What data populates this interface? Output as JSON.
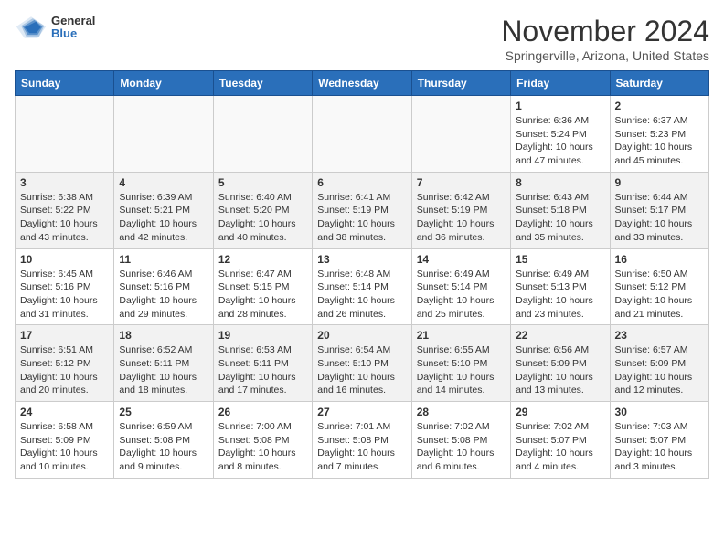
{
  "header": {
    "logo": {
      "general": "General",
      "blue": "Blue"
    },
    "title": "November 2024",
    "subtitle": "Springerville, Arizona, United States"
  },
  "days_of_week": [
    "Sunday",
    "Monday",
    "Tuesday",
    "Wednesday",
    "Thursday",
    "Friday",
    "Saturday"
  ],
  "weeks": [
    [
      {
        "day": "",
        "info": ""
      },
      {
        "day": "",
        "info": ""
      },
      {
        "day": "",
        "info": ""
      },
      {
        "day": "",
        "info": ""
      },
      {
        "day": "",
        "info": ""
      },
      {
        "day": "1",
        "info": "Sunrise: 6:36 AM\nSunset: 5:24 PM\nDaylight: 10 hours and 47 minutes."
      },
      {
        "day": "2",
        "info": "Sunrise: 6:37 AM\nSunset: 5:23 PM\nDaylight: 10 hours and 45 minutes."
      }
    ],
    [
      {
        "day": "3",
        "info": "Sunrise: 6:38 AM\nSunset: 5:22 PM\nDaylight: 10 hours and 43 minutes."
      },
      {
        "day": "4",
        "info": "Sunrise: 6:39 AM\nSunset: 5:21 PM\nDaylight: 10 hours and 42 minutes."
      },
      {
        "day": "5",
        "info": "Sunrise: 6:40 AM\nSunset: 5:20 PM\nDaylight: 10 hours and 40 minutes."
      },
      {
        "day": "6",
        "info": "Sunrise: 6:41 AM\nSunset: 5:19 PM\nDaylight: 10 hours and 38 minutes."
      },
      {
        "day": "7",
        "info": "Sunrise: 6:42 AM\nSunset: 5:19 PM\nDaylight: 10 hours and 36 minutes."
      },
      {
        "day": "8",
        "info": "Sunrise: 6:43 AM\nSunset: 5:18 PM\nDaylight: 10 hours and 35 minutes."
      },
      {
        "day": "9",
        "info": "Sunrise: 6:44 AM\nSunset: 5:17 PM\nDaylight: 10 hours and 33 minutes."
      }
    ],
    [
      {
        "day": "10",
        "info": "Sunrise: 6:45 AM\nSunset: 5:16 PM\nDaylight: 10 hours and 31 minutes."
      },
      {
        "day": "11",
        "info": "Sunrise: 6:46 AM\nSunset: 5:16 PM\nDaylight: 10 hours and 29 minutes."
      },
      {
        "day": "12",
        "info": "Sunrise: 6:47 AM\nSunset: 5:15 PM\nDaylight: 10 hours and 28 minutes."
      },
      {
        "day": "13",
        "info": "Sunrise: 6:48 AM\nSunset: 5:14 PM\nDaylight: 10 hours and 26 minutes."
      },
      {
        "day": "14",
        "info": "Sunrise: 6:49 AM\nSunset: 5:14 PM\nDaylight: 10 hours and 25 minutes."
      },
      {
        "day": "15",
        "info": "Sunrise: 6:49 AM\nSunset: 5:13 PM\nDaylight: 10 hours and 23 minutes."
      },
      {
        "day": "16",
        "info": "Sunrise: 6:50 AM\nSunset: 5:12 PM\nDaylight: 10 hours and 21 minutes."
      }
    ],
    [
      {
        "day": "17",
        "info": "Sunrise: 6:51 AM\nSunset: 5:12 PM\nDaylight: 10 hours and 20 minutes."
      },
      {
        "day": "18",
        "info": "Sunrise: 6:52 AM\nSunset: 5:11 PM\nDaylight: 10 hours and 18 minutes."
      },
      {
        "day": "19",
        "info": "Sunrise: 6:53 AM\nSunset: 5:11 PM\nDaylight: 10 hours and 17 minutes."
      },
      {
        "day": "20",
        "info": "Sunrise: 6:54 AM\nSunset: 5:10 PM\nDaylight: 10 hours and 16 minutes."
      },
      {
        "day": "21",
        "info": "Sunrise: 6:55 AM\nSunset: 5:10 PM\nDaylight: 10 hours and 14 minutes."
      },
      {
        "day": "22",
        "info": "Sunrise: 6:56 AM\nSunset: 5:09 PM\nDaylight: 10 hours and 13 minutes."
      },
      {
        "day": "23",
        "info": "Sunrise: 6:57 AM\nSunset: 5:09 PM\nDaylight: 10 hours and 12 minutes."
      }
    ],
    [
      {
        "day": "24",
        "info": "Sunrise: 6:58 AM\nSunset: 5:09 PM\nDaylight: 10 hours and 10 minutes."
      },
      {
        "day": "25",
        "info": "Sunrise: 6:59 AM\nSunset: 5:08 PM\nDaylight: 10 hours and 9 minutes."
      },
      {
        "day": "26",
        "info": "Sunrise: 7:00 AM\nSunset: 5:08 PM\nDaylight: 10 hours and 8 minutes."
      },
      {
        "day": "27",
        "info": "Sunrise: 7:01 AM\nSunset: 5:08 PM\nDaylight: 10 hours and 7 minutes."
      },
      {
        "day": "28",
        "info": "Sunrise: 7:02 AM\nSunset: 5:08 PM\nDaylight: 10 hours and 6 minutes."
      },
      {
        "day": "29",
        "info": "Sunrise: 7:02 AM\nSunset: 5:07 PM\nDaylight: 10 hours and 4 minutes."
      },
      {
        "day": "30",
        "info": "Sunrise: 7:03 AM\nSunset: 5:07 PM\nDaylight: 10 hours and 3 minutes."
      }
    ]
  ]
}
